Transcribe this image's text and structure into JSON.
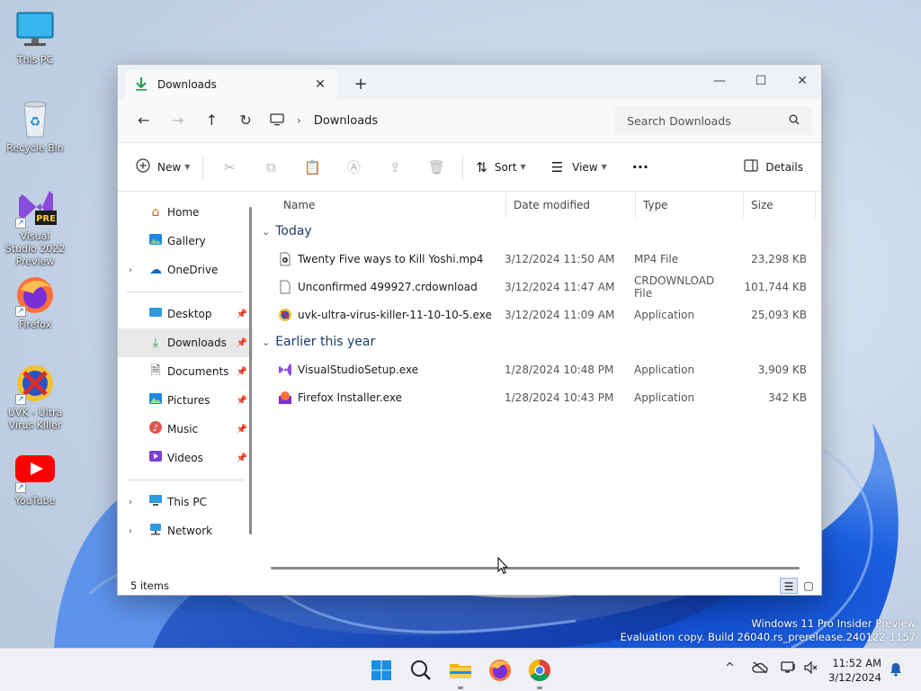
{
  "desktop": {
    "icons": [
      {
        "label": "This PC"
      },
      {
        "label": "Recycle Bin"
      },
      {
        "label": "Visual Studio 2022 Preview",
        "badge": "PRE"
      },
      {
        "label": "Firefox"
      },
      {
        "label": "UVK - Ultra Virus Killer"
      },
      {
        "label": "YouTube"
      }
    ]
  },
  "window": {
    "tab_title": "Downloads",
    "tab_close": "✕",
    "new_tab": "+",
    "controls": {
      "minimize": "—",
      "maximize": "☐",
      "close": "✕"
    },
    "nav": {
      "back": "←",
      "forward": "→",
      "up": "↑",
      "refresh": "↻"
    },
    "address": {
      "location": "Downloads",
      "separator": "›"
    },
    "search_placeholder": "Search Downloads",
    "toolbar": {
      "new_label": "New",
      "sort_label": "Sort",
      "view_label": "View",
      "more_label": "···",
      "details_label": "Details"
    },
    "sidebar": {
      "home": "Home",
      "gallery": "Gallery",
      "onedrive": "OneDrive",
      "desktop": "Desktop",
      "downloads": "Downloads",
      "documents": "Documents",
      "pictures": "Pictures",
      "music": "Music",
      "videos": "Videos",
      "thispc": "This PC",
      "network": "Network"
    },
    "columns": {
      "name": "Name",
      "date": "Date modified",
      "type": "Type",
      "size": "Size"
    },
    "groups": [
      {
        "title": "Today",
        "files": [
          {
            "name": "Twenty Five ways to Kill Yoshi.mp4",
            "date": "3/12/2024 11:50 AM",
            "type": "MP4 File",
            "size": "23,298 KB"
          },
          {
            "name": "Unconfirmed 499927.crdownload",
            "date": "3/12/2024 11:47 AM",
            "type": "CRDOWNLOAD File",
            "size": "101,744 KB"
          },
          {
            "name": "uvk-ultra-virus-killer-11-10-10-5.exe",
            "date": "3/12/2024 11:09 AM",
            "type": "Application",
            "size": "25,093 KB"
          }
        ]
      },
      {
        "title": "Earlier this year",
        "files": [
          {
            "name": "VisualStudioSetup.exe",
            "date": "1/28/2024 10:48 PM",
            "type": "Application",
            "size": "3,909 KB"
          },
          {
            "name": "Firefox Installer.exe",
            "date": "1/28/2024 10:43 PM",
            "type": "Application",
            "size": "342 KB"
          }
        ]
      }
    ],
    "status": "5 items"
  },
  "watermark": {
    "line1": "Windows 11 Pro Insider Preview",
    "line2": "Evaluation copy. Build 26040.rs_prerelease.240122-1157"
  },
  "taskbar": {
    "time": "11:52 AM",
    "date": "3/12/2024",
    "tray_chevron": "^"
  }
}
